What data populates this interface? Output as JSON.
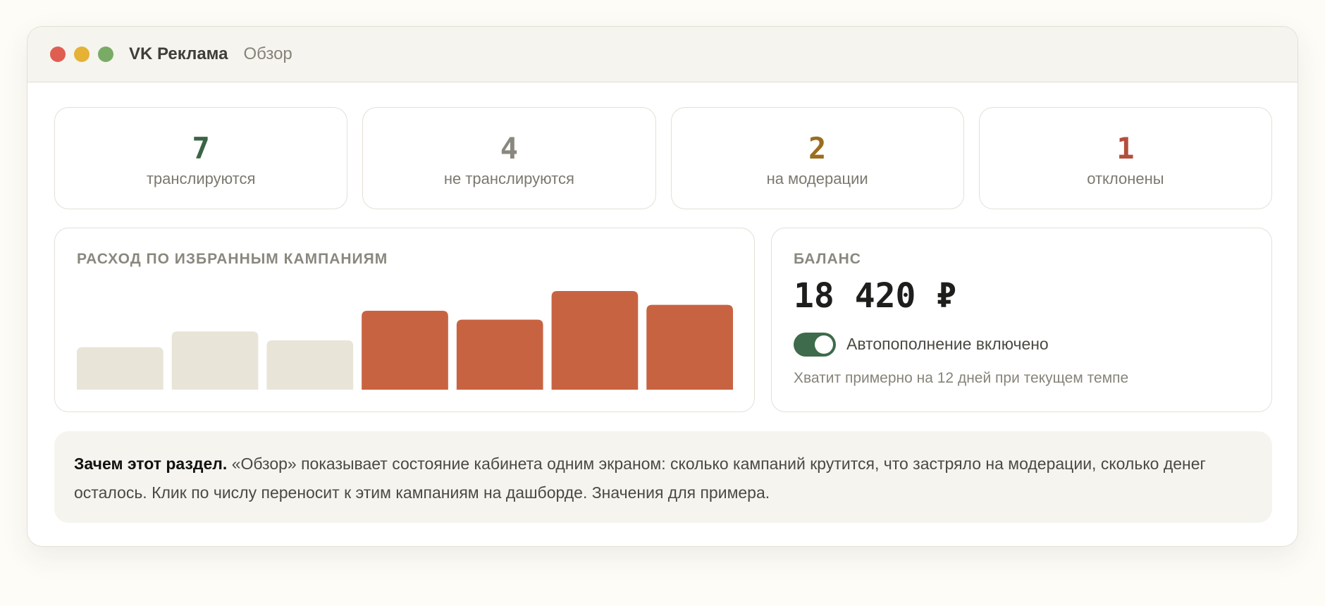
{
  "window": {
    "app_title": "VK Реклама",
    "crumb": "Обзор"
  },
  "stats": [
    {
      "value": "7",
      "label": "транслируются",
      "color": "#3b6447"
    },
    {
      "value": "4",
      "label": "не транслируются",
      "color": "#8a887e"
    },
    {
      "value": "2",
      "label": "на модерации",
      "color": "#9a6d1f"
    },
    {
      "value": "1",
      "label": "отклонены",
      "color": "#b34f3d"
    }
  ],
  "spend": {
    "title": "РАСХОД ПО ИЗБРАННЫМ КАМПАНИЯМ",
    "chart_data": {
      "type": "bar",
      "values": [
        0.43,
        0.59,
        0.5,
        0.8,
        0.71,
        1.0,
        0.86
      ],
      "highlight": [
        false,
        false,
        false,
        true,
        true,
        true,
        true
      ],
      "colors": {
        "muted": "#e8e4d8",
        "accent": "#c86342"
      }
    }
  },
  "balance": {
    "title": "БАЛАНС",
    "value": "18 420 ₽",
    "autopay_label": "Автопополнение включено",
    "autopay_on": true,
    "hint": "Хватит примерно на 12 дней при текущем темпе"
  },
  "note": {
    "bold": "Зачем этот раздел.",
    "text": " «Обзор» показывает состояние кабинета одним экраном: сколько кампаний крутится, что застряло на модерации, сколько денег осталось. Клик по числу переносит к этим кампаниям на дашборде. Значения для примера."
  }
}
